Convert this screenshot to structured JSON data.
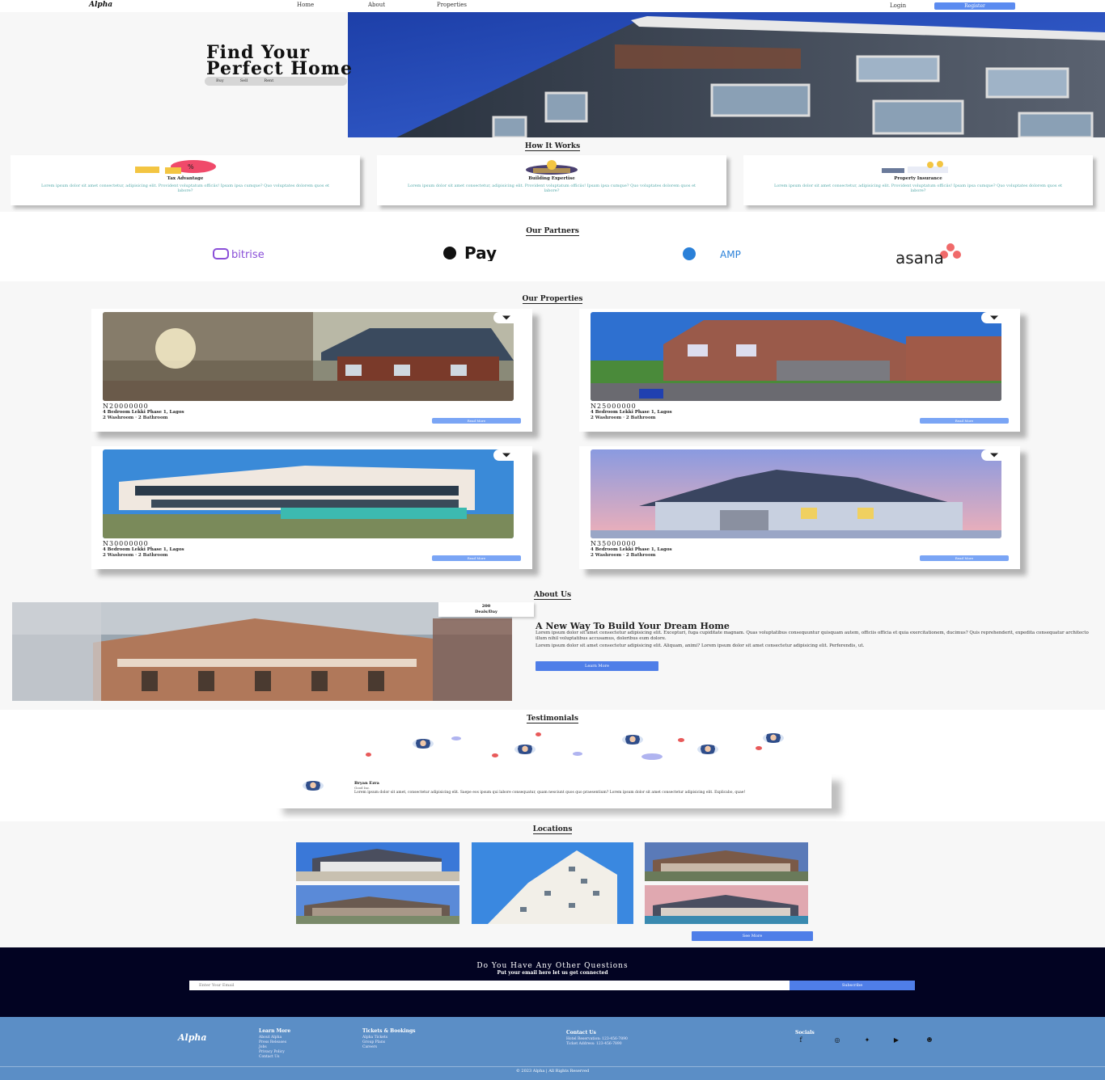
{
  "nav": {
    "logo": "Alpha",
    "links": [
      "Home",
      "About",
      "Properties"
    ],
    "login": "Login",
    "register": "Register"
  },
  "hero": {
    "title_line1": "Find Your",
    "title_line2": "Perfect Home",
    "tabs": [
      "Buy",
      "Sell",
      "Rent"
    ]
  },
  "how_it_works": {
    "title": "How It Works",
    "cards": [
      {
        "title": "Tax Advantage",
        "text": "Lorem ipsum dolor sit amet consectetur, adipisicing elit. Provident voluptatum officiis! Ipsam ipsa cumque? Quo voluptates dolorem quos et labore?"
      },
      {
        "title": "Building Expertise",
        "text": "Lorem ipsum dolor sit amet consectetur, adipisicing elit. Provident voluptatum officiis! Ipsam ipsa cumque? Quo voluptates dolorem quos et labore?"
      },
      {
        "title": "Property Insurance",
        "text": "Lorem ipsum dolor sit amet consectetur, adipisicing elit. Provident voluptatum officiis! Ipsam ipsa cumque? Quo voluptates dolorem quos et labore?"
      }
    ]
  },
  "partners": {
    "title": "Our Partners",
    "logos": [
      "bitrise",
      "Pay",
      "AMP",
      "asana"
    ]
  },
  "properties": {
    "title": "Our Properties",
    "items": [
      {
        "price": "N20000000",
        "location": "4 Bedroom Lekki Phase 1, Lagos",
        "features": "2 Washroom · 2 Bathroom",
        "button": "Read More"
      },
      {
        "price": "N25000000",
        "location": "4 Bedroom Lekki Phase 1, Lagos",
        "features": "2 Washroom · 2 Bathroom",
        "button": "Read More"
      },
      {
        "price": "N30000000",
        "location": "4 Bedroom Lekki Phase 1, Lagos",
        "features": "2 Washroom · 2 Bathroom",
        "button": "Read More"
      },
      {
        "price": "N35000000",
        "location": "4 Bedroom Lekki Phase 1, Lagos",
        "features": "2 Washroom · 2 Bathroom",
        "button": "Read More"
      }
    ]
  },
  "about": {
    "title": "About Us",
    "deals_count": "200",
    "deals_label": "Deals/Day",
    "heading": "A New Way To Build Your Dream Home",
    "text1": "Lorem ipsum dolor sit amet consectetur adipisicing elit. Excepturi, fuga cupiditate magnam. Quas voluptatibus consequuntur quisquam autem, officiis officia et quia exercitationem, ducimus? Quis reprehenderit, expedita consequatur architecto illum nihil voluptatibus accusamus, doloribus eum dolore.",
    "text2": "Lorem ipsum dolor sit amet consectetur adipisicing elit. Aliquam, animi? Lorem ipsum dolor sit amet consectetur adipisicing elit. Perferendis, ut.",
    "button": "Learn More"
  },
  "testimonials": {
    "title": "Testimonials",
    "name": "Bryan Ezra",
    "role": "Good Inc.",
    "text": "Lorem ipsum dolor sit amet, consectetur adipisicing elit. Saepe eos ipsum qui labore consequatur, quam nesciunt quos quo praesentium? Lorem ipsum dolor sit amet consectetur adipisicing elit. Explicabo, quae!"
  },
  "locations": {
    "title": "Locations",
    "button": "See More"
  },
  "newsletter": {
    "title": "Do You Have Any Other Questions",
    "subtitle": "Put your email here let us get connected",
    "placeholder": "Enter Your Email",
    "button": "Subscribe"
  },
  "footer": {
    "logo": "Alpha",
    "learn_more": {
      "title": "Learn More",
      "items": [
        "About Alpha",
        "Press Releases",
        "Jobs",
        "Privacy Policy",
        "Contact Us"
      ]
    },
    "tickets": {
      "title": "Tickets & Bookings",
      "items": [
        "Alpha Tickets",
        "Group Plans",
        "Careers"
      ]
    },
    "contact": {
      "title": "Contact Us",
      "items": [
        "Hotel Reservation: 123-456-7890",
        "Ticket Address: 123-456-7890"
      ]
    },
    "social": {
      "title": "Socials"
    },
    "copyright": "© 2023 Alpha | All Rights Reserved"
  },
  "colors": {
    "accent": "#4f7ee8",
    "newsletter_bg": "#020322",
    "footer_bg": "#5b8ec6"
  }
}
